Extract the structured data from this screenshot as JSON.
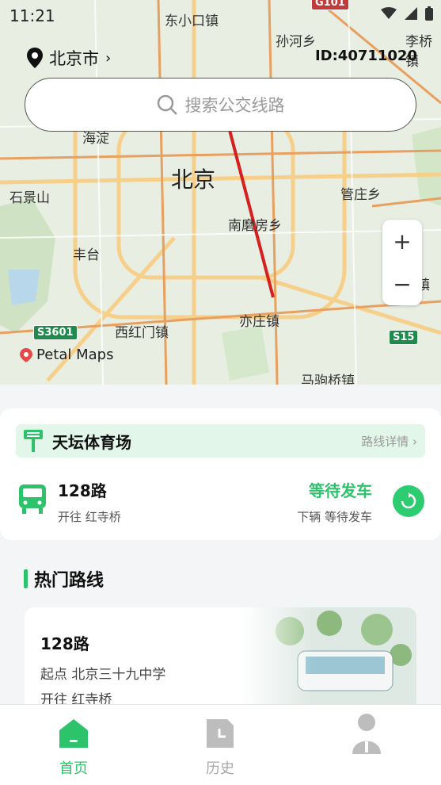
{
  "status": {
    "time": "11:21"
  },
  "header": {
    "city": "北京市",
    "user_id": "ID:40711020"
  },
  "search": {
    "placeholder": "搜索公交线路"
  },
  "map": {
    "labels": [
      "东小口镇",
      "孙河乡",
      "李桥镇",
      "北京",
      "石景山",
      "管庄乡",
      "南磨房乡",
      "丰台",
      "公期镇",
      "西红门镇",
      "亦庄镇",
      "马驹桥镇",
      "海淀"
    ],
    "shields": [
      "S3601",
      "S15",
      "G101"
    ],
    "brand": "Petal Maps",
    "zoom_in": "+",
    "zoom_out": "−"
  },
  "stop_card": {
    "stop_name": "天坛体育场",
    "detail_link": "路线详情",
    "route": "128路",
    "direction": "开往 红寺桥",
    "status": "等待发车",
    "status_sub": "下辆 等待发车"
  },
  "hot": {
    "title": "热门路线",
    "items": [
      {
        "route": "128路",
        "start": "起点 北京三十九中学",
        "direction": "开往 红寺桥"
      }
    ]
  },
  "tabs": [
    {
      "label": "首页",
      "icon": "home-icon",
      "active": true
    },
    {
      "label": "历史",
      "icon": "history-icon",
      "active": false
    },
    {
      "label": "",
      "icon": "user-icon",
      "active": false
    }
  ],
  "colors": {
    "accent": "#2cc36b",
    "accent_light": "#e2f6ea",
    "tab_inactive": "#a8a8a8"
  }
}
